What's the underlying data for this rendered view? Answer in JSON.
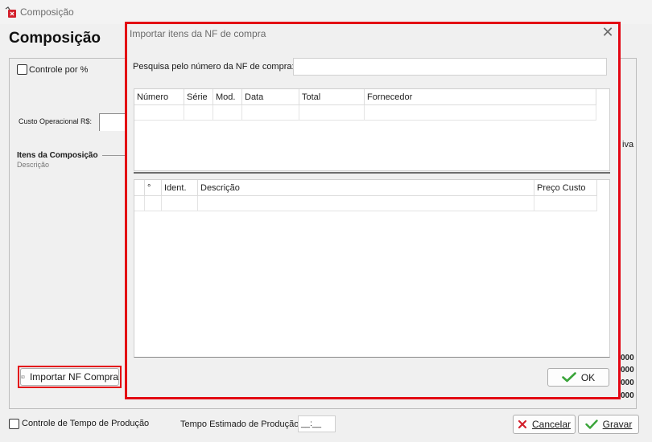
{
  "window": {
    "title": "Composição"
  },
  "page": {
    "title": "Composição"
  },
  "panel": {
    "controle_percent_label": "Controle por %",
    "custo_operacional_label": "Custo Operacional R$:",
    "itens_label": "Itens da Composição",
    "descricao_label": "Descrição",
    "right_text": "iva",
    "right_values": [
      "000",
      "000",
      "000",
      "000"
    ]
  },
  "importar_button": {
    "label": "Importar NF Compra"
  },
  "footer": {
    "controle_tempo_label": "Controle de Tempo de Produção",
    "tempo_estimado_label": "Tempo Estimado de Produção",
    "tempo_value": "__:__",
    "cancelar_label": "Cancelar",
    "gravar_label": "Gravar"
  },
  "dialog": {
    "title": "Importar itens da NF de compra",
    "search_label": "Pesquisa pelo número da NF de compra:",
    "search_value": "",
    "nf_columns": [
      "Número",
      "Série",
      "Mod.",
      "Data",
      "Total",
      "Fornecedor"
    ],
    "items_columns": [
      "°",
      "Ident.",
      "Descrição",
      "Preço Custo"
    ],
    "ok_label": "OK"
  },
  "colors": {
    "highlight": "#e30613",
    "ok_check": "#3aa43a",
    "cancel_x": "#d3202c"
  }
}
